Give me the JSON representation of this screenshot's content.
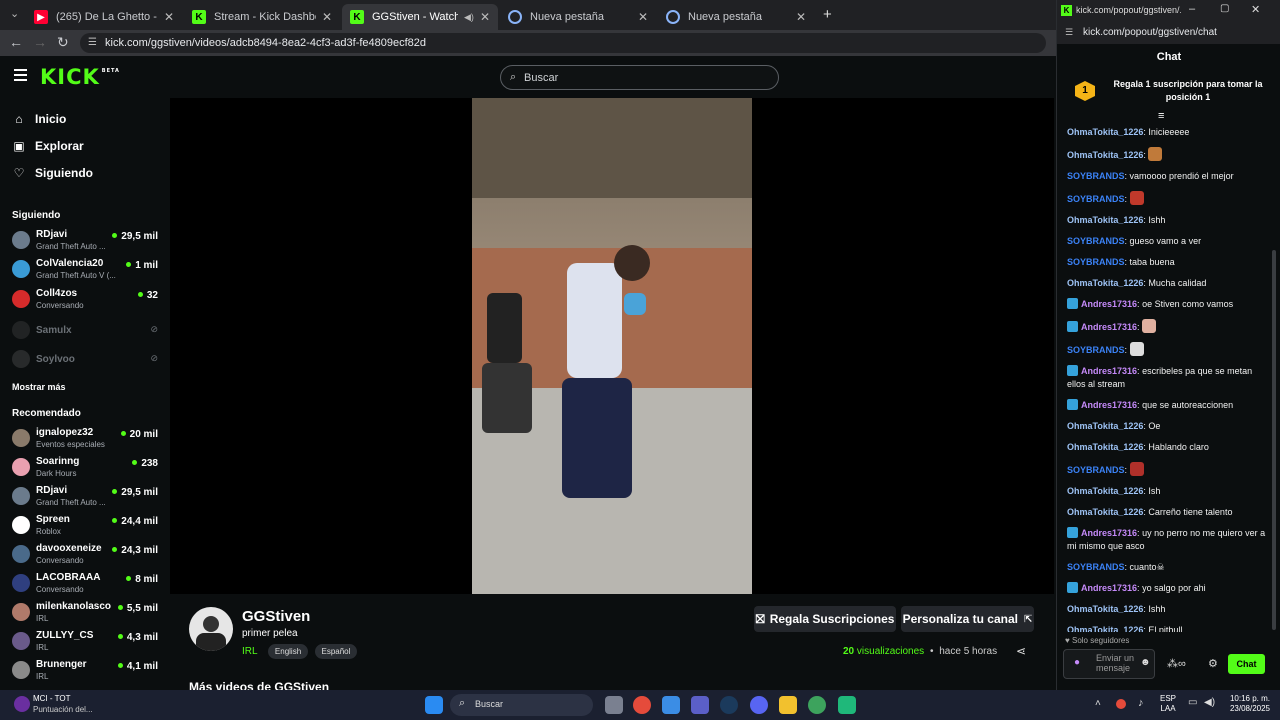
{
  "browser": {
    "tabs": [
      {
        "title": "(265) De La Ghetto - Fronteam...",
        "icon": "youtube-icon",
        "color": "#ff0033",
        "active": false
      },
      {
        "title": "Stream - Kick Dashboard",
        "icon": "kick-icon",
        "color": "#53fc18",
        "active": false
      },
      {
        "title": "GGStiven - Watch the VOD",
        "icon": "kick-icon",
        "color": "#53fc18",
        "active": true
      },
      {
        "title": "Nueva pestaña",
        "icon": "chrome-icon",
        "color": "#8ab4f8",
        "active": false
      },
      {
        "title": "Nueva pestaña",
        "icon": "chrome-icon",
        "color": "#8ab4f8",
        "active": false
      }
    ],
    "new_tab": "+",
    "url": "kick.com/ggstiven/videos/adcb8494-8ea2-4cf3-ad3f-fe4809ecf82d"
  },
  "kick": {
    "logo": "KICK",
    "logo_badge": "BETA",
    "search_placeholder": "Buscar",
    "nav": [
      {
        "label": "Inicio",
        "icon": "home-icon"
      },
      {
        "label": "Explorar",
        "icon": "compass-icon"
      },
      {
        "label": "Siguiendo",
        "icon": "heart-icon"
      }
    ],
    "following_title": "Siguiendo",
    "following": [
      {
        "name": "RDjavi",
        "game": "Grand Theft Auto ...",
        "viewers": "29,5 mil",
        "color": "#6b7b8c"
      },
      {
        "name": "ColValencia20",
        "game": "Grand Theft Auto V (...",
        "viewers": "1 mil",
        "color": "#3a9bd6"
      },
      {
        "name": "Coll4zos",
        "game": "Conversando",
        "viewers": "32",
        "color": "#d62b2b"
      }
    ],
    "offline": [
      {
        "name": "Samulx",
        "color": "#444"
      },
      {
        "name": "Soylvoo",
        "color": "#555"
      }
    ],
    "show_more": "Mostrar más",
    "recommended_title": "Recomendado",
    "recommended": [
      {
        "name": "ignalopez32",
        "game": "Eventos especiales",
        "viewers": "20 mil",
        "color": "#8a7a6a"
      },
      {
        "name": "Soarinng",
        "game": "Dark Hours",
        "viewers": "238",
        "color": "#e9a0b0"
      },
      {
        "name": "RDjavi",
        "game": "Grand Theft Auto ...",
        "viewers": "29,5 mil",
        "color": "#6b7b8c"
      },
      {
        "name": "Spreen",
        "game": "Roblox",
        "viewers": "24,4 mil",
        "color": "#ffffff"
      },
      {
        "name": "davooxeneize",
        "game": "Conversando",
        "viewers": "24,3 mil",
        "color": "#4a6a8a"
      },
      {
        "name": "LACOBRAAA",
        "game": "Conversando",
        "viewers": "8 mil",
        "color": "#2f3f7f"
      },
      {
        "name": "milenkanolasco",
        "game": "IRL",
        "viewers": "5,5 mil",
        "color": "#b07a6a"
      },
      {
        "name": "ZULLYY_CS",
        "game": "IRL",
        "viewers": "4,3 mil",
        "color": "#6a5a8a"
      },
      {
        "name": "Brunenger",
        "game": "IRL",
        "viewers": "4,1 mil",
        "color": "#8a8a8a"
      }
    ],
    "video": {
      "channel": "GGStiven",
      "title": "primer pelea",
      "category": "IRL",
      "tags": [
        "English",
        "Español"
      ],
      "gift_button": "Regala Suscripciones",
      "customize_button": "Personaliza tu canal",
      "views_count": "20",
      "views_label": "visualizaciones",
      "separator": "•",
      "time_ago": "hace 5 horas",
      "more_videos": "Más videos de GGStiven"
    }
  },
  "popout": {
    "window_title": "kick.com/popout/ggstiven/...",
    "url": "kick.com/popout/ggstiven/chat",
    "chat_title": "Chat",
    "gift_rank": "1",
    "gift_text": "Regala 1 suscripción para tomar la posición 1",
    "messages": [
      {
        "user": "OhmaTokita_1226",
        "text": "Inicieeeee",
        "color": "#9ec3f5",
        "badge": false,
        "emote": ""
      },
      {
        "user": "OhmaTokita_1226",
        "text": "",
        "color": "#9ec3f5",
        "badge": false,
        "emote": "#c07a3a"
      },
      {
        "user": "SOYBRANDS",
        "text": "vamoooo prendió el mejor",
        "color": "#3b82f6",
        "badge": false,
        "emote": ""
      },
      {
        "user": "SOYBRANDS",
        "text": "",
        "color": "#3b82f6",
        "badge": false,
        "emote": "#c0392b"
      },
      {
        "user": "OhmaTokita_1226",
        "text": "Ishh",
        "color": "#9ec3f5",
        "badge": false,
        "emote": ""
      },
      {
        "user": "SOYBRANDS",
        "text": "gueso vamo a ver",
        "color": "#3b82f6",
        "badge": false,
        "emote": ""
      },
      {
        "user": "SOYBRANDS",
        "text": "taba buena",
        "color": "#3b82f6",
        "badge": false,
        "emote": ""
      },
      {
        "user": "OhmaTokita_1226",
        "text": "Mucha calidad",
        "color": "#9ec3f5",
        "badge": false,
        "emote": ""
      },
      {
        "user": "Andres17316",
        "text": "oe Stiven como vamos",
        "color": "#c58af9",
        "badge": true,
        "emote": ""
      },
      {
        "user": "Andres17316",
        "text": "",
        "color": "#c58af9",
        "badge": true,
        "emote": "#e0b0a0"
      },
      {
        "user": "SOYBRANDS",
        "text": "",
        "color": "#3b82f6",
        "badge": false,
        "emote": "#dddddd"
      },
      {
        "user": "Andres17316",
        "text": "escribeles pa que se metan ellos al stream",
        "color": "#c58af9",
        "badge": true,
        "emote": ""
      },
      {
        "user": "Andres17316",
        "text": "que se autoreaccionen",
        "color": "#c58af9",
        "badge": true,
        "emote": ""
      },
      {
        "user": "OhmaTokita_1226",
        "text": "Oe",
        "color": "#9ec3f5",
        "badge": false,
        "emote": ""
      },
      {
        "user": "OhmaTokita_1226",
        "text": "Hablando claro",
        "color": "#9ec3f5",
        "badge": false,
        "emote": ""
      },
      {
        "user": "SOYBRANDS",
        "text": "",
        "color": "#3b82f6",
        "badge": false,
        "emote": "#b0302a"
      },
      {
        "user": "OhmaTokita_1226",
        "text": "Ish",
        "color": "#9ec3f5",
        "badge": false,
        "emote": ""
      },
      {
        "user": "OhmaTokita_1226",
        "text": "Carreño tiene talento",
        "color": "#9ec3f5",
        "badge": false,
        "emote": ""
      },
      {
        "user": "Andres17316",
        "text": "uy no perro no me quiero ver a mi mismo que asco",
        "color": "#c58af9",
        "badge": true,
        "emote": ""
      },
      {
        "user": "SOYBRANDS",
        "text": "cuanto☠",
        "color": "#3b82f6",
        "badge": false,
        "emote": ""
      },
      {
        "user": "Andres17316",
        "text": "yo salgo por ahi",
        "color": "#c58af9",
        "badge": true,
        "emote": ""
      },
      {
        "user": "OhmaTokita_1226",
        "text": "Ishh",
        "color": "#9ec3f5",
        "badge": false,
        "emote": ""
      },
      {
        "user": "OhmaTokita_1226",
        "text": "El pitbull",
        "color": "#9ec3f5",
        "badge": false,
        "emote": ""
      }
    ],
    "followers_only": "Solo seguidores",
    "input_placeholder": "Enviar un mensaje",
    "send_button": "Chat"
  },
  "taskbar": {
    "notification_title": "MCI - TOT",
    "notification_sub": "Puntuación del...",
    "search_placeholder": "Buscar",
    "lang": "ESP",
    "lang_sub": "LAA",
    "time": "10:16 p. m.",
    "date": "23/08/2025"
  },
  "colors": {
    "kick_green": "#53fc18",
    "bg": "#0b0e0f",
    "sidebar_text": "#ffffff"
  }
}
